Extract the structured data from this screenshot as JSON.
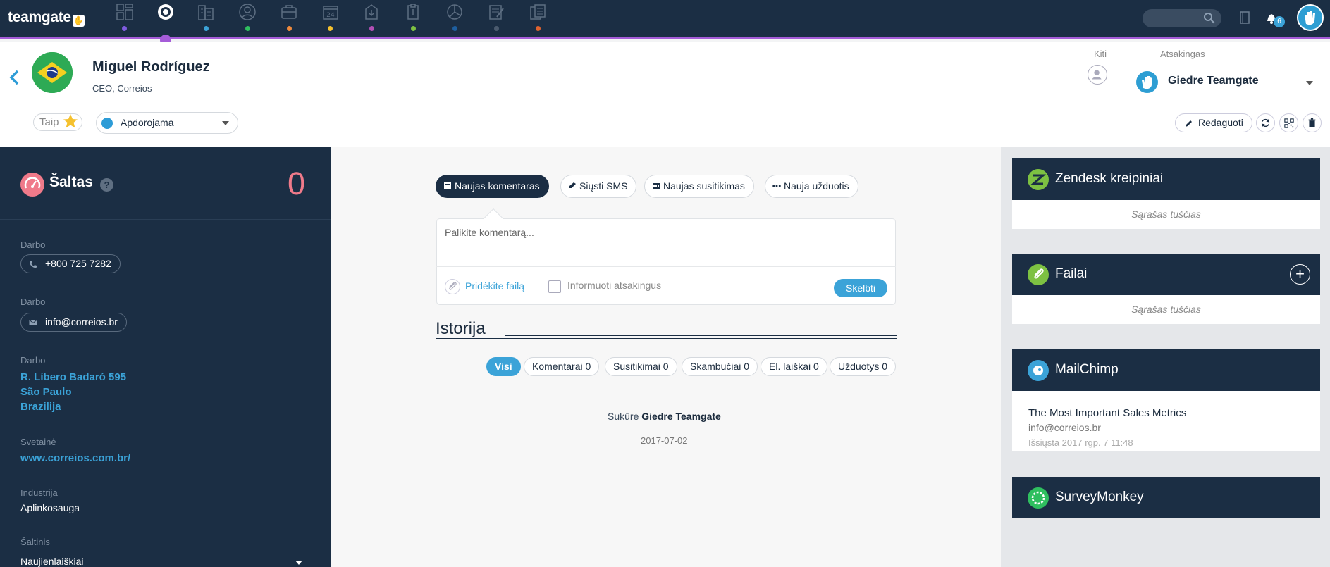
{
  "app": {
    "logo": "teamgate",
    "notifications_count": "6",
    "search_placeholder": ""
  },
  "nav": {
    "icons": [
      {
        "name": "dashboard-icon",
        "color": "#7f5ce0"
      },
      {
        "name": "target-icon",
        "color": "#a55cd8"
      },
      {
        "name": "companies-icon",
        "color": "#3ba3d8"
      },
      {
        "name": "people-icon",
        "color": "#2fbf5f"
      },
      {
        "name": "deals-icon",
        "color": "#f08a3c"
      },
      {
        "name": "calendar-icon",
        "color": "#f5c12e"
      },
      {
        "name": "download-icon",
        "color": "#b34fb5"
      },
      {
        "name": "clipboard-icon",
        "color": "#7dc142"
      },
      {
        "name": "reports-icon",
        "color": "#1e5fa0"
      },
      {
        "name": "notes-icon",
        "color": "#4a5a6e"
      },
      {
        "name": "invoices-icon",
        "color": "#e0632f"
      }
    ]
  },
  "contact": {
    "name": "Miguel Rodríguez",
    "subtitle": "CEO, Correios",
    "favorite_label": "Taip",
    "status": "Apdorojama",
    "kiti_label": "Kiti",
    "owner_label": "Atsakingas",
    "owner_name": "Giedre Teamgate",
    "edit_label": "Redaguoti"
  },
  "sidebar": {
    "temperature_label": "Šaltas",
    "temperature_value": "0",
    "phone_label": "Darbo",
    "phone": "+800 725 7282",
    "email_label": "Darbo",
    "email": "info@correios.br",
    "address_label": "Darbo",
    "address_lines": [
      "R. Líbero Badaró 595",
      "São Paulo",
      "Brazilija"
    ],
    "website_label": "Svetainė",
    "website": "www.correios.com.br/",
    "industry_label": "Industrija",
    "industry": "Aplinkosauga",
    "source_label": "Šaltinis",
    "source": "Naujienlaiškiai"
  },
  "activity": {
    "tabs": [
      "Naujas komentaras",
      "Siųsti SMS",
      "Naujas susitikimas",
      "Nauja užduotis"
    ],
    "comment_placeholder": "Palikite komentarą...",
    "attach_label": "Pridėkite failą",
    "notify_label": "Informuoti atsakingus",
    "post_label": "Skelbti",
    "history_title": "Istorija",
    "filters": [
      "Visi",
      "Komentarai 0",
      "Susitikimai 0",
      "Skambučiai 0",
      "El. laiškai 0",
      "Užduotys 0"
    ],
    "created_prefix": "Sukūrė",
    "created_by": "Giedre Teamgate",
    "created_date": "2017-07-02"
  },
  "widgets": {
    "zendesk_title": "Zendesk kreipiniai",
    "zendesk_empty": "Sąrašas tuščias",
    "files_title": "Failai",
    "files_empty": "Sąrašas tuščias",
    "mailchimp_title": "MailChimp",
    "mailchimp_campaign": "The Most Important Sales Metrics",
    "mailchimp_email": "info@correios.br",
    "mailchimp_sent": "Išsiųsta 2017 rgp. 7 11:48",
    "surveymonkey_title": "SurveyMonkey"
  },
  "colors": {
    "navy": "#1b2e44",
    "accent": "#3ba3d8",
    "cold": "#f07a8a",
    "purple": "#a55cd8"
  }
}
